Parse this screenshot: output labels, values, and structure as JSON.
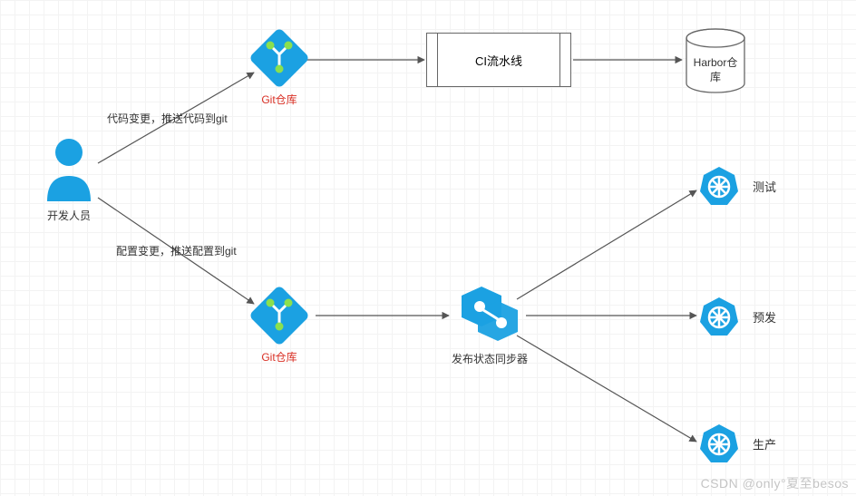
{
  "nodes": {
    "developer": {
      "label": "开发人员"
    },
    "git_repo_top": {
      "label": "Git仓库"
    },
    "git_repo_bottom": {
      "label": "Git仓库"
    },
    "ci_pipeline": {
      "label": "CI流水线"
    },
    "harbor": {
      "label": "Harbor仓\n库"
    },
    "sync": {
      "label": "发布状态同步器"
    },
    "env_test": {
      "label": "测试"
    },
    "env_pre": {
      "label": "预发"
    },
    "env_prod": {
      "label": "生产"
    }
  },
  "edges": {
    "code_change": {
      "label": "代码变更，推送代码到git"
    },
    "config_change": {
      "label": "配置变更，推送配置到git"
    }
  },
  "watermark": "CSDN @only°夏至besos",
  "colors": {
    "accent": "#1ba1e2",
    "accent_dark": "#0e7fb8"
  }
}
